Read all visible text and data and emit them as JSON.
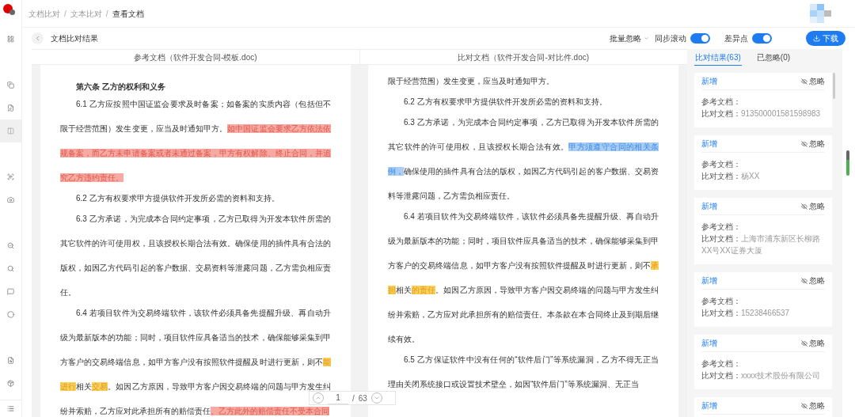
{
  "breadcrumb": [
    {
      "label": "文档比对",
      "current": false
    },
    {
      "separator": "/",
      "label": "文本比对",
      "current": false
    },
    {
      "separator": "/",
      "label": "查看文档",
      "current": true
    }
  ],
  "sidebar": {
    "groups": [
      [
        {
          "selected": false
        }
      ],
      [
        {
          "selected": false
        },
        {
          "selected": false
        },
        {
          "selected": true
        }
      ],
      [
        {
          "selected": false
        },
        {
          "selected": false
        }
      ],
      [
        {
          "selected": false
        },
        {
          "selected": false
        },
        {
          "selected": false
        },
        {
          "selected": false
        }
      ],
      [
        {
          "selected": false
        },
        {
          "selected": false
        }
      ]
    ]
  },
  "toolbar": {
    "title": "文档比对结果",
    "batch_ignore": "批量忽略",
    "sync_scroll": {
      "label": "同步滚动",
      "on": true
    },
    "diff_points": {
      "label": "差异点",
      "on": true
    },
    "download": "下载"
  },
  "documents": [
    {
      "header": "参考文档（软件开发合同-模板.doc)",
      "paragraphs": [
        {
          "kind": "heading",
          "segments": [
            {
              "text": "第六条 乙方的权利和义务",
              "kind": "plain"
            }
          ]
        },
        {
          "kind": "body",
          "segments": [
            {
              "text": "6.1 乙方应按照中国证监会要求及时备案；如备案的实质内容（包括但不限于经营范围）发生变更，应当及时通知甲方。",
              "kind": "plain"
            },
            {
              "text": "如中国证监会要求乙方依法依规备案，而乙方未申请备案或者未通过备案，甲方有权解除、终止合同，并追究乙方违约责任。",
              "kind": "deleted"
            }
          ]
        },
        {
          "kind": "body",
          "segments": [
            {
              "text": "6.2 乙方有权要求甲方提供软件开发所必需的资料和支持。",
              "kind": "plain"
            }
          ]
        },
        {
          "kind": "body",
          "segments": [
            {
              "text": "6.3 乙方承诺，为完成本合同约定事项，乙方已取得为开发本软件所需的其它软件的许可使用权，且该授权长期合法有效。确保使用的插件具有合法的版权，如因乙方代码引起的客户数据、交易资料等泄露问题，乙方需负相应责任。",
              "kind": "plain"
            }
          ]
        },
        {
          "kind": "body",
          "segments": [
            {
              "text": "6.4 若项目软件为交易终端软件，该软件必须具备先提醒升级、再自动升级为最新版本的功能；同时，项目软件应具备适当的技术，确保能够采集到甲方客户的交易终端信息，如甲方客户没有按照软件提醒及时进行更新，则不",
              "kind": "plain"
            },
            {
              "text": "能进行",
              "kind": "changed"
            },
            {
              "text": "相关",
              "kind": "plain"
            },
            {
              "text": "交易",
              "kind": "changed"
            },
            {
              "text": "。如因乙方原因，导致甲方客户因交易终端的问题与甲方发生纠纷并索赔，乙方应对此承担所有的赔偿责任",
              "kind": "plain"
            },
            {
              "text": "。乙方此外的赔偿责任不受本合同",
              "kind": "deleted"
            }
          ]
        }
      ]
    },
    {
      "header": "比对文档（软件开发合同-对比件.doc)",
      "paragraphs": [
        {
          "kind": "continuation",
          "segments": [
            {
              "text": "限于经营范围）发生变更，应当及时通知甲方。",
              "kind": "plain"
            }
          ]
        },
        {
          "kind": "body",
          "segments": [
            {
              "text": "6.2 乙方有权要求甲方提供软件开发所必需的资料和支持。",
              "kind": "plain"
            }
          ]
        },
        {
          "kind": "body",
          "segments": [
            {
              "text": "6.3 乙方承诺，为完成本合同约定事项，乙方已取得为开发本软件所需的其它软件的许可使用权，且该授权长期合法有效。",
              "kind": "plain"
            },
            {
              "text": "甲方须遵守合同的相关条例，",
              "kind": "added"
            },
            {
              "text": "确保使用的插件具有合法的版权，如因乙方代码引起的客户数据、交易资料等泄露问题，乙方需负相应责任。",
              "kind": "plain"
            }
          ]
        },
        {
          "kind": "body",
          "segments": [
            {
              "text": "6.4 若项目软件为交易终端软件，该软件必须具备先提醒升级、再自动升级为最新版本的功能；同时，项目软件应具备适当的技术，确保能够采集到甲方客户的交易终端信息，如甲方客户没有按照软件提醒及时进行更新，则不",
              "kind": "plain"
            },
            {
              "text": "承担",
              "kind": "changed"
            },
            {
              "text": "相关",
              "kind": "plain"
            },
            {
              "text": "的责任",
              "kind": "changed"
            },
            {
              "text": "。如因乙方原因，导致甲方客户因交易终端的问题与甲方发生纠纷并索赔，乙方应对此承担所有的赔偿责任。本条款在本合同终止及到期后继续有效。",
              "kind": "plain"
            }
          ]
        },
        {
          "kind": "body",
          "segments": [
            {
              "text": "6.5 乙方保证软件中没有任何的“软件后门”等系统漏洞，乙方不得无正当理由关闭系统接口或设置技术壁垒，如因“软件后门”等系统漏洞、无正当",
              "kind": "plain"
            }
          ]
        }
      ]
    }
  ],
  "pager": {
    "page": "1",
    "separator": "/",
    "total": "63"
  },
  "results": {
    "tabs": [
      {
        "label": "比对结果(63)",
        "selected": true
      },
      {
        "label": "已忽略(0)",
        "selected": false
      }
    ],
    "items": [
      {
        "type": "新增",
        "ignore": "忽略",
        "reference_label": "参考文档：",
        "compare_label": "比对文档：",
        "compare": "913500001581598983"
      },
      {
        "type": "新增",
        "ignore": "忽略",
        "reference_label": "参考文档：",
        "compare_label": "比对文档：",
        "compare": "杨XX"
      },
      {
        "type": "新增",
        "ignore": "忽略",
        "reference_label": "参考文档：",
        "compare_label": "比对文档：",
        "compare": "上海市浦东新区长柳路XX号XX证券大厦"
      },
      {
        "type": "新增",
        "ignore": "忽略",
        "reference_label": "参考文档：",
        "compare_label": "比对文档：",
        "compare": "15238466537"
      },
      {
        "type": "新增",
        "ignore": "忽略",
        "reference_label": "参考文档：",
        "compare_label": "比对文档：",
        "compare": "xxxx技术股份有限公司"
      },
      {
        "type": "新增",
        "ignore": "忽略"
      }
    ]
  }
}
